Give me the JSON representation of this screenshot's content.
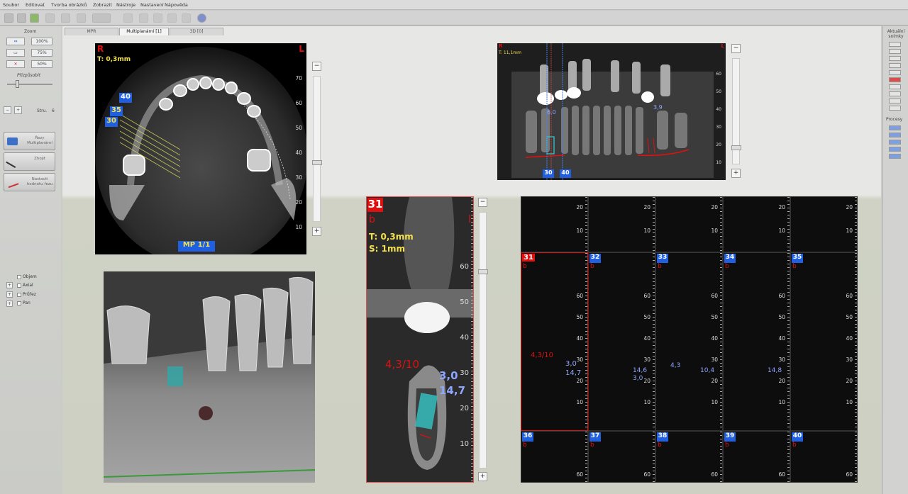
{
  "menu": [
    "Soubor",
    "Editovat",
    "Tvorba obrázků",
    "Zobrazit",
    "Nástroje",
    "Nastavení",
    "Nápověda"
  ],
  "tabs": [
    "MPR",
    "Multiplanární [1]",
    "3D [0]"
  ],
  "left": {
    "zoom_label": "Zoom",
    "z100": "100%",
    "z75": "75%",
    "z50": "50%",
    "fit_label": "Přizpůsobit",
    "step_label": "Stru.",
    "step_value": "6",
    "btn_multi": "Řezy Multiplanární",
    "btn_tool2": "Zhojit",
    "btn_tool3": "Nastavit hodnotu řezu",
    "checks": [
      "Objem",
      "Axial",
      "Průřez",
      "Pan"
    ]
  },
  "right": {
    "title": "Aktuální snímky",
    "section2": "Procesy"
  },
  "axial": {
    "r": "R",
    "l": "L",
    "thickness": "T: 0,3mm",
    "badge": "MP 1/1",
    "n40": "40",
    "n35": "35",
    "n30": "30",
    "ticks": [
      "70",
      "60",
      "50",
      "40",
      "30",
      "20",
      "10"
    ]
  },
  "pan": {
    "r": "R",
    "l": "L",
    "thickness": "T: 11,1mm",
    "m1": "6,0",
    "m2": "3,9",
    "n30": "30",
    "n40": "40",
    "ticks": [
      "60",
      "50",
      "40",
      "30",
      "20",
      "10"
    ]
  },
  "cross": {
    "num": "31",
    "b": "b",
    "l": "l",
    "thickness": "T: 0,3mm",
    "slice": "S: 1mm",
    "m_red": "4,3/10",
    "m_b1": "3,0",
    "m_b2": "14,7",
    "ticks": [
      "60",
      "50",
      "40",
      "30",
      "20",
      "10"
    ]
  },
  "grid": {
    "top_ticks": [
      "20",
      "10"
    ],
    "mid_ticks": [
      "60",
      "50",
      "40",
      "30",
      "20",
      "10"
    ],
    "bot_tick": "60",
    "mid_cells": [
      "31",
      "32",
      "33",
      "34",
      "35"
    ],
    "bot_cells": [
      "36",
      "37",
      "38",
      "39",
      "40"
    ],
    "b": "b",
    "ann31": "4,3/10",
    "ann31b": "3,0",
    "ann31c": "14,7",
    "ann32a": "14,6",
    "ann32b": "3,0",
    "ann33a": "4,3",
    "ann33b": "10,4",
    "ann34": "14,8"
  },
  "colors": {
    "accent": "#2060e0",
    "marker_red": "#e01010",
    "implant": "#35c6c6",
    "label_yellow": "#f4e04a",
    "measure_blue": "#8fa6ff"
  }
}
